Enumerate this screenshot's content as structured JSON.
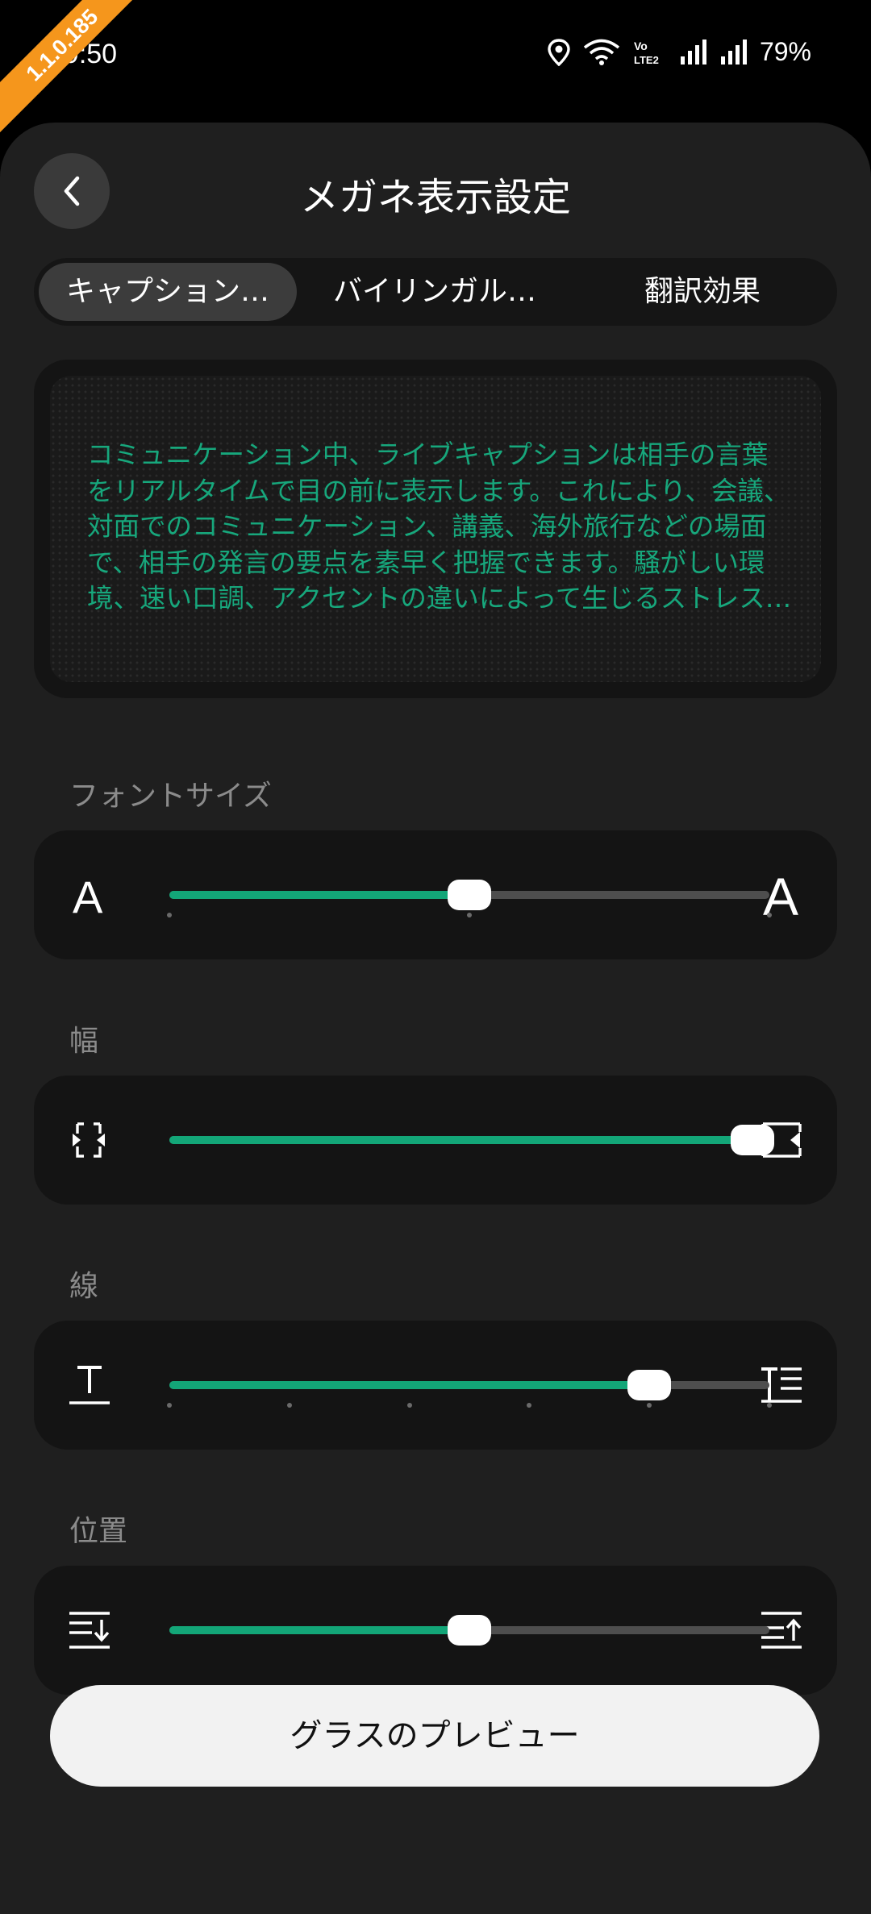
{
  "status_bar": {
    "time": "19:50",
    "build_badge": "1.1.0.185",
    "battery": "79%",
    "icons": [
      "location-icon",
      "wifi-icon",
      "volte-icon",
      "signal-icon",
      "signal-icon"
    ]
  },
  "header": {
    "title": "メガネ表示設定",
    "back_icon": "chevron-left-icon"
  },
  "tabs": [
    {
      "label": "キャプション…",
      "active": true
    },
    {
      "label": "バイリンガル…",
      "active": false
    },
    {
      "label": "翻訳効果",
      "active": false
    }
  ],
  "preview": {
    "text": "コミュニケーション中、ライブキャプションは相手の言葉\nをリアルタイムで目の前に表示します。これにより、会議、\n対面でのコミュニケーション、講義、海外旅行などの場面\nで、相手の発言の要点を素早く把握できます。騒がしい環\n境、速い口調、アクセントの違いによって生じるストレス…",
    "text_color": "#17a77c"
  },
  "sliders": {
    "font_size": {
      "label": "フォントサイズ",
      "min_icon_text": "A",
      "max_icon_text": "A",
      "value": 0.5,
      "steps": 3
    },
    "width": {
      "label": "幅",
      "min_icon": "shrink-width-icon",
      "max_icon": "expand-width-icon",
      "value": 1.0,
      "steps": 0
    },
    "lines": {
      "label": "線",
      "min_icon": "single-line-text-icon",
      "max_icon": "multi-line-text-icon",
      "value": 0.8,
      "steps": 6
    },
    "position": {
      "label": "位置",
      "min_icon": "align-bottom-icon",
      "max_icon": "align-top-icon",
      "value": 0.5,
      "steps": 0
    }
  },
  "colors": {
    "accent": "#13a678",
    "track": "#4e4e4e",
    "sheet_bg": "#1f1f1f",
    "card_bg": "#141414",
    "badge": "#f5961c"
  },
  "footer": {
    "preview_button": "グラスのプレビュー"
  }
}
